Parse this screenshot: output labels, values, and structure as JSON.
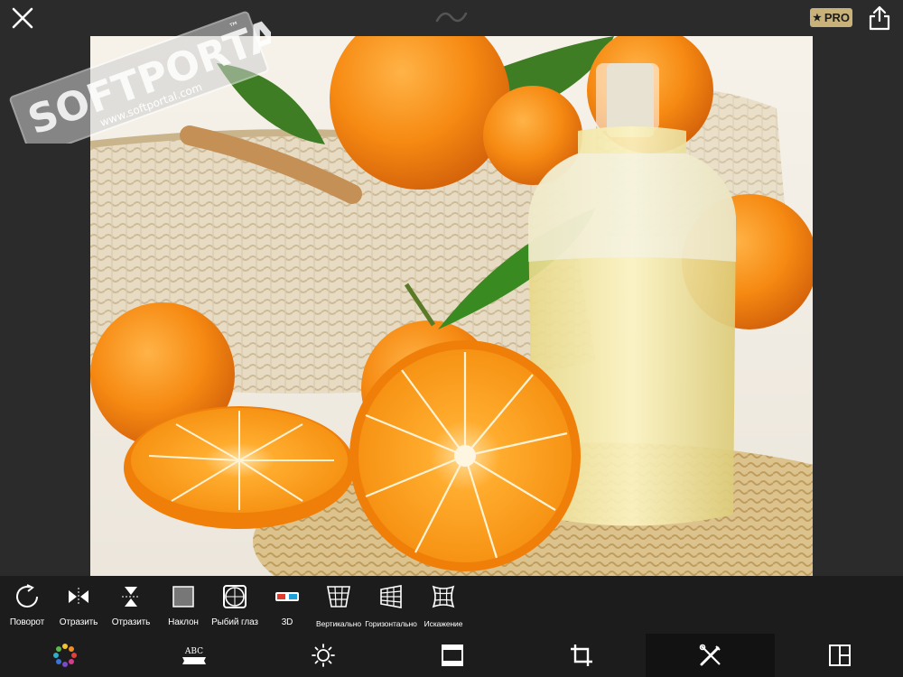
{
  "header": {
    "close_icon": "close-icon",
    "logo_icon": "tilde-logo-icon",
    "pro_label": "PRO",
    "share_icon": "share-icon",
    "pro_color": "#c9b27a"
  },
  "watermark": {
    "brand": "SOFTPORTAL",
    "tm": "™",
    "url": "www.softportal.com"
  },
  "tools": [
    {
      "label": "Поворот",
      "icon": "rotate-icon"
    },
    {
      "label": "Отразить",
      "icon": "flip-horizontal-icon"
    },
    {
      "label": "Отразить",
      "icon": "flip-vertical-icon"
    },
    {
      "label": "Наклон",
      "icon": "tilt-icon"
    },
    {
      "label": "Рыбий глаз",
      "icon": "fisheye-icon"
    },
    {
      "label": "3D",
      "icon": "3d-glasses-icon"
    },
    {
      "label": "Вертикально",
      "icon": "vertical-perspective-icon"
    },
    {
      "label": "Горизонтально",
      "icon": "horizontal-perspective-icon"
    },
    {
      "label": "Искажение",
      "icon": "distortion-icon"
    }
  ],
  "tabs": [
    {
      "icon": "color-palette-icon",
      "active": false
    },
    {
      "icon": "text-banner-icon",
      "text": "ABC",
      "active": false
    },
    {
      "icon": "brightness-icon",
      "active": false
    },
    {
      "icon": "frame-icon",
      "active": false
    },
    {
      "icon": "crop-icon",
      "active": false
    },
    {
      "icon": "tools-icon",
      "active": true
    },
    {
      "icon": "layout-icon",
      "active": false
    }
  ]
}
